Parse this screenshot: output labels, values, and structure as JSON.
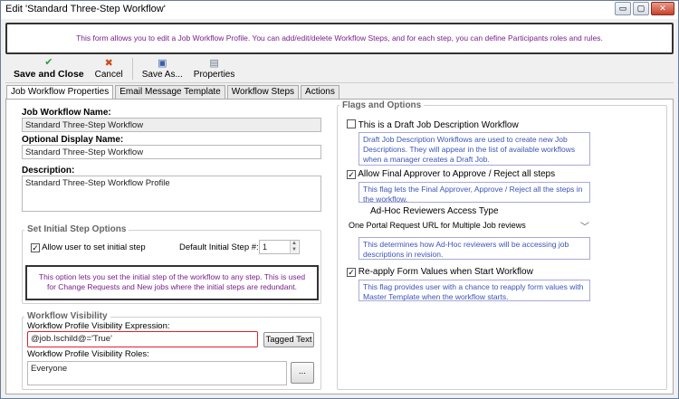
{
  "window": {
    "title": "Edit 'Standard Three-Step Workflow'",
    "controls": {
      "minimize": "▭",
      "maximize": "▢",
      "close": "✕"
    }
  },
  "banner": {
    "text": "This form allows you to edit a Job Workflow Profile. You can add/edit/delete Workflow Steps, and for each step, you can define Participants roles and rules."
  },
  "toolbar": {
    "save_close": {
      "label": "Save and Close",
      "icon": "✔",
      "icon_name": "checkmark-icon",
      "color": "#2e9e3a"
    },
    "cancel": {
      "label": "Cancel",
      "icon": "✖",
      "icon_name": "cancel-icon",
      "color": "#d04a1a"
    },
    "save_as": {
      "label": "Save As...",
      "icon": "▣",
      "icon_name": "floppy-disk-icon",
      "color": "#3a5fa8"
    },
    "properties": {
      "label": "Properties",
      "icon": "▤",
      "icon_name": "properties-icon",
      "color": "#6b7b8c"
    }
  },
  "tabs": [
    {
      "label": "Job Workflow Properties",
      "active": true
    },
    {
      "label": "Email Message Template",
      "active": false
    },
    {
      "label": "Workflow Steps",
      "active": false
    },
    {
      "label": "Actions",
      "active": false
    }
  ],
  "left": {
    "workflow_name_label": "Job Workflow Name:",
    "workflow_name_value": "Standard Three-Step Workflow",
    "display_name_label": "Optional Display Name:",
    "display_name_value": "Standard Three-Step Workflow",
    "description_label": "Description:",
    "description_value": "Standard Three-Step Workflow Profile",
    "initial_step": {
      "group_title": "Set Initial Step Options",
      "allow_label": "Allow user to set initial step",
      "allow_checked": "✓",
      "default_label": "Default Initial Step #:",
      "default_value": "1",
      "note": "This option lets you set the initial step of the workflow to any step.  This is used for Change Requests and New jobs where the initial steps are redundant."
    },
    "visibility": {
      "group_title": "Workflow Visibility",
      "expression_label": "Workflow Profile Visibility Expression:",
      "expression_value": "@job.Ischild@='True'",
      "tagged_text_button": "Tagged Text",
      "roles_label": "Workflow Profile Visibility Roles:",
      "roles_value": "Everyone",
      "browse_button": "..."
    }
  },
  "right": {
    "group_title": "Flags and Options",
    "draft": {
      "label": "This is a Draft Job Description Workflow",
      "checked": "",
      "info": "Draft Job Description Workflows are used to create new Job Descriptions. They will appear in the list of available workflows when a manager creates a Draft Job."
    },
    "final_approver": {
      "label": "Allow Final Approver to Approve / Reject all steps",
      "checked": "✓",
      "info": "This flag lets the Final Approver, Approve / Reject all the steps in the workflow."
    },
    "adhoc": {
      "title": "Ad-Hoc Reviewers Access Type",
      "selected": "One Portal Request URL for Multiple Job reviews",
      "info": "This determines how Ad-Hoc reviewers will be accessing job descriptions in revision."
    },
    "reapply": {
      "label": "Re-apply Form Values when Start Workflow",
      "checked": "✓",
      "info": "This flag provides user with a chance to reapply form values with Master Template when the workflow starts."
    }
  },
  "colors": {
    "banner_text": "#7a1f8c",
    "info_text": "#3b55b8",
    "error_border": "#d9252a"
  }
}
